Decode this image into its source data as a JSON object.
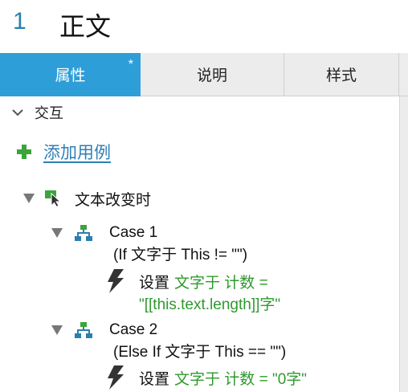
{
  "header": {
    "number": "1",
    "title": "正文"
  },
  "tabs": [
    {
      "label": "属性",
      "modified_marker": "*"
    },
    {
      "label": "说明"
    },
    {
      "label": "样式"
    }
  ],
  "interactions": {
    "section_label": "交互",
    "add_case_label": "添加用例",
    "event": {
      "label": "文本改变时",
      "cases": [
        {
          "name": "Case 1",
          "condition": "(If 文字于 This != \"\")",
          "action_prefix": "设置",
          "action_line1": "文字于 计数 =",
          "action_line2": "\"[[this.text.length]]字\""
        },
        {
          "name": "Case 2",
          "condition": "(Else If 文字于 This == \"\")",
          "action_prefix": "设置",
          "action_line1": "文字于 计数 = \"0字\""
        }
      ]
    }
  },
  "colors": {
    "accent_tab": "#2e9ed8",
    "link": "#2f7fb6",
    "action_green": "#2e9a2e",
    "header_number": "#2a7fb0"
  },
  "icons": [
    "chevron-down-icon",
    "add-icon",
    "expand-triangle-icon",
    "event-cursor-icon",
    "case-tree-icon",
    "lightning-icon"
  ]
}
